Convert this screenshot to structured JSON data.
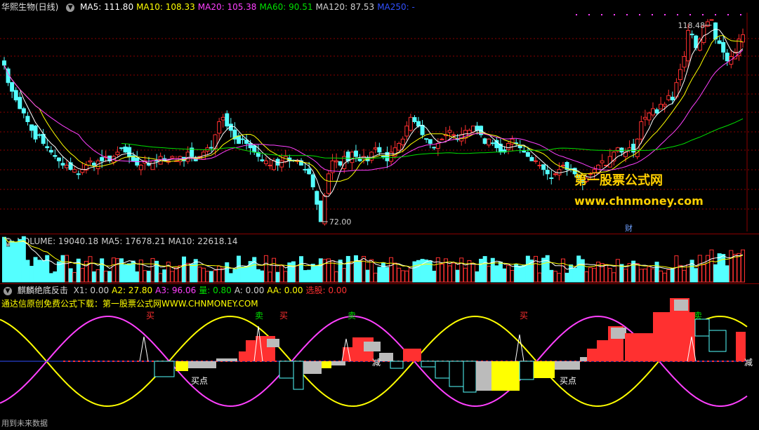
{
  "main_panel": {
    "stock_name": "华熙生物(日线)",
    "ma_labels": [
      {
        "label": "MA5: 111.80",
        "color": "#ffffff"
      },
      {
        "label": "MA10: 108.33",
        "color": "#ffff00"
      },
      {
        "label": "MA20: 105.38",
        "color": "#ff40ff"
      },
      {
        "label": "MA60: 90.51",
        "color": "#00e000"
      },
      {
        "label": "MA120: 87.53",
        "color": "#d0d0d0"
      },
      {
        "label": "MA250: -",
        "color": "#3050ff"
      }
    ],
    "high_label": "118.48",
    "low_label": "72.00",
    "fin_marker": "财"
  },
  "volume_panel": {
    "labels": [
      {
        "label": "VOLUME: 19040.18",
        "color": "#d0d0d0"
      },
      {
        "label": "MA5: 17678.21",
        "color": "#d0d0d0"
      },
      {
        "label": "MA10: 22618.14",
        "color": "#d0d0d0"
      }
    ]
  },
  "indicator_panel": {
    "name": "麒麟绝底反击",
    "values": [
      {
        "label": "X1: 0.00",
        "color": "#d0d0d0"
      },
      {
        "label": "A2: 27.80",
        "color": "#ffff00"
      },
      {
        "label": "A3: 96.06",
        "color": "#ff40ff"
      },
      {
        "label": "量: 0.80",
        "color": "#00e000"
      },
      {
        "label": "A: 0.00",
        "color": "#d0d0d0"
      },
      {
        "label": "AA: 0.00",
        "color": "#ffff00"
      },
      {
        "label": "选股: 0.00",
        "color": "#ff3030"
      }
    ],
    "promo_text": "通达信原创免费公式下载：第一股票公式网WWW.CHNMONEY.COM",
    "buy_label": "买",
    "sell_label": "卖",
    "buy_point_label": "买点",
    "reduce_label": "减"
  },
  "watermark": {
    "line1": "第一股票公式网",
    "line2": "www.chnmoney.com"
  },
  "footer": {
    "text": "用到未来数据"
  },
  "colors": {
    "up": "#ff3030",
    "down": "#54ffff",
    "ma5": "#ffffff",
    "ma10": "#ffff00",
    "ma20": "#ff40ff",
    "ma60": "#00e000",
    "grid": "#8b0000"
  },
  "chart_data": [
    {
      "type": "candlestick",
      "title": "华熙生物(日线)",
      "ylim": [
        72.0,
        118.48
      ],
      "annotations": [
        "118.48",
        "72.00"
      ],
      "series": [
        {
          "name": "MA5",
          "color": "#ffffff",
          "values": []
        },
        {
          "name": "MA10",
          "color": "#ffff00",
          "values": []
        },
        {
          "name": "MA20",
          "color": "#ff40ff",
          "values": []
        },
        {
          "name": "MA60",
          "color": "#00e000",
          "values": []
        }
      ],
      "closes": [
        108,
        104,
        102,
        100,
        98,
        97,
        95,
        93,
        91,
        92,
        90,
        89,
        88,
        87,
        86,
        85,
        85,
        84,
        84,
        83,
        84,
        85,
        86,
        85,
        86,
        86,
        87,
        86,
        87,
        88,
        89,
        88,
        87,
        86,
        85,
        85,
        86,
        85,
        86,
        86,
        87,
        86,
        86,
        87,
        86,
        87,
        86,
        88,
        87,
        86,
        87,
        88,
        89,
        89,
        92,
        95,
        96,
        94,
        93,
        91,
        90,
        91,
        90,
        89,
        88,
        87,
        86,
        86,
        85,
        86,
        85,
        86,
        87,
        86,
        86,
        86,
        85,
        84,
        83,
        80,
        76,
        72,
        78,
        83,
        86,
        86,
        85,
        87,
        86,
        88,
        87,
        86,
        87,
        86,
        88,
        89,
        88,
        87,
        86,
        88,
        89,
        90,
        91,
        94,
        96,
        95,
        94,
        92,
        91,
        90,
        89,
        90,
        91,
        92,
        93,
        92,
        91,
        92,
        93,
        93,
        94,
        93,
        92,
        90,
        91,
        90,
        89,
        88,
        88,
        90,
        91,
        90,
        89,
        88,
        87,
        86,
        86,
        85,
        84,
        83,
        82,
        83,
        84,
        85,
        84,
        84,
        83,
        82,
        81,
        82,
        83,
        84,
        85,
        86,
        85,
        87,
        88,
        89,
        88,
        88,
        89,
        88,
        91,
        95,
        96,
        97,
        98,
        97,
        99,
        99,
        101,
        100,
        104,
        107,
        110,
        116,
        115,
        112,
        114,
        117,
        118,
        118.48,
        114,
        113,
        111,
        109,
        110,
        111,
        114,
        115
      ]
    },
    {
      "type": "bar",
      "title": "VOLUME",
      "values_note": "daily volume bars",
      "series": [
        {
          "name": "VOLUME",
          "values": []
        },
        {
          "name": "MA5",
          "values": []
        },
        {
          "name": "MA10",
          "values": []
        }
      ]
    },
    {
      "type": "line",
      "title": "麒麟绝底反击",
      "series": [
        {
          "name": "A2",
          "color": "#ffff00",
          "values": []
        },
        {
          "name": "A3",
          "color": "#ff40ff",
          "values": []
        }
      ]
    }
  ]
}
